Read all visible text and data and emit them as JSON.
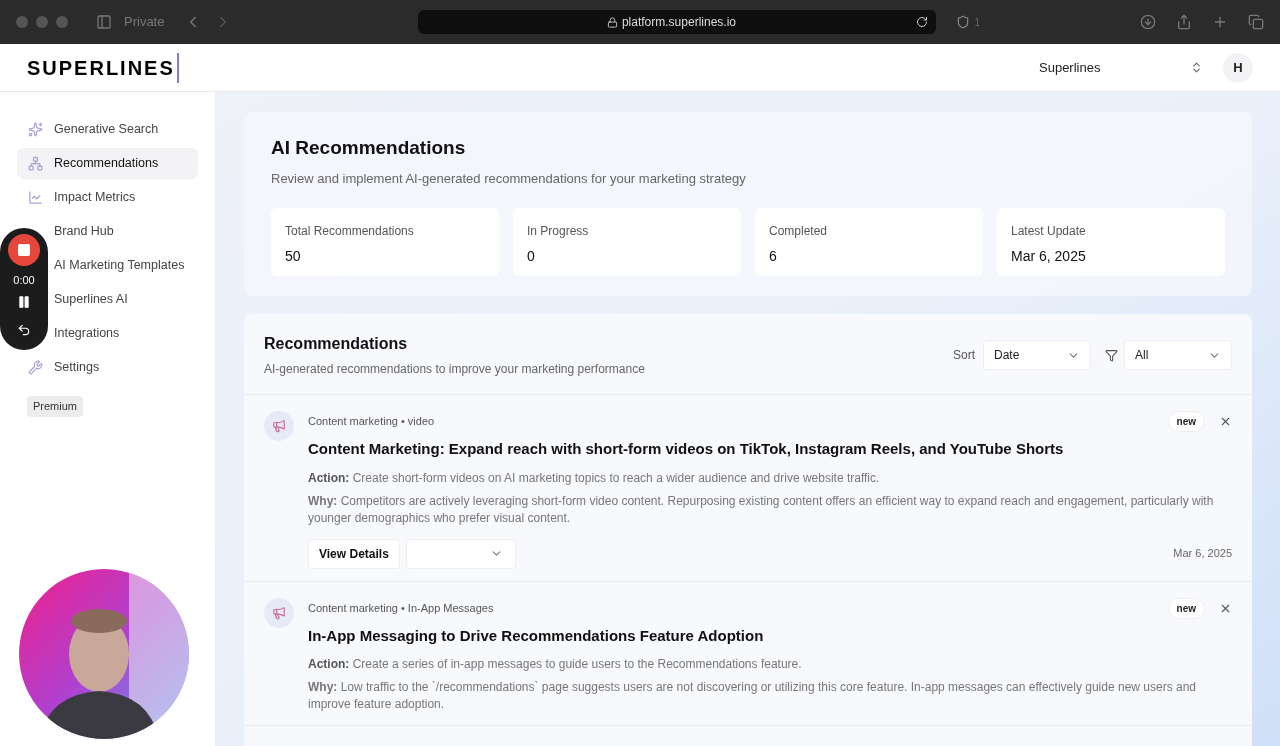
{
  "browser": {
    "private_label": "Private",
    "url": "platform.superlines.io",
    "shield_count": "1"
  },
  "header": {
    "logo": "SUPERLINES",
    "workspace": "Superlines",
    "avatar": "H"
  },
  "sidebar": {
    "items": [
      {
        "label": "Generative Search",
        "selected": false
      },
      {
        "label": "Recommendations",
        "selected": true
      },
      {
        "label": "Impact Metrics",
        "selected": false
      },
      {
        "label": "Brand Hub",
        "selected": false
      },
      {
        "label": "AI Marketing Templates",
        "selected": false
      },
      {
        "label": "Superlines AI",
        "selected": false
      },
      {
        "label": "Integrations",
        "selected": false
      },
      {
        "label": "Settings",
        "selected": false
      }
    ],
    "plan_badge": "Premium"
  },
  "recorder": {
    "time": "0:00"
  },
  "overview": {
    "title": "AI Recommendations",
    "subtitle": "Review and implement AI-generated recommendations for your marketing strategy",
    "stats": [
      {
        "label": "Total Recommendations",
        "value": "50"
      },
      {
        "label": "In Progress",
        "value": "0"
      },
      {
        "label": "Completed",
        "value": "6"
      },
      {
        "label": "Latest Update",
        "value": "Mar 6, 2025"
      }
    ]
  },
  "recommendations": {
    "title": "Recommendations",
    "subtitle": "AI-generated recommendations to improve your marketing performance",
    "sort_label": "Sort",
    "sort_value": "Date",
    "filter_value": "All",
    "items": [
      {
        "category": "Content marketing • video",
        "badge": "new",
        "title": "Content Marketing: Expand reach with short-form videos on TikTok, Instagram Reels, and YouTube Shorts",
        "action": "**Action:** Create short-form videos on AI marketing topics to reach a wider audience and drive website traffic.",
        "why": "**Why:** Competitors are actively leveraging short-form video content. Repurposing existing content offers an efficient way to expand reach and engagement, particularly with younger demographics who prefer visual content.",
        "details_button": "View Details",
        "date": "Mar 6, 2025"
      },
      {
        "category": "Content marketing • In-App Messages",
        "badge": "new",
        "title": "In-App Messaging to Drive Recommendations Feature Adoption",
        "action": "**Action:** Create a series of in-app messages to guide users to the Recommendations feature.",
        "why": "**Why:** Low traffic to the `/recommendations` page suggests users are not discovering or utilizing this core feature. In-app messages can effectively guide new users and improve feature adoption."
      }
    ]
  }
}
